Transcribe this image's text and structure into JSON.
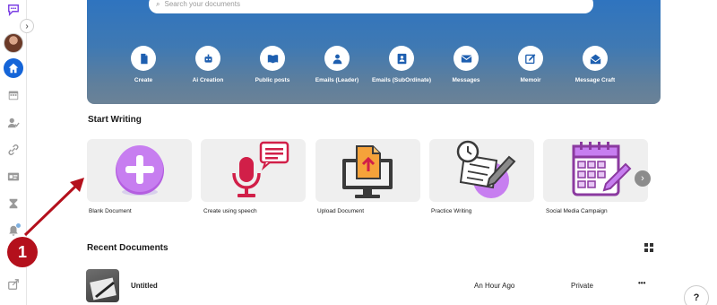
{
  "search": {
    "placeholder": "Search your documents"
  },
  "quick_actions": [
    {
      "label": "Create",
      "icon": "document-icon"
    },
    {
      "label": "Ai Creation",
      "icon": "robot-icon"
    },
    {
      "label": "Public posts",
      "icon": "book-icon"
    },
    {
      "label": "Emails (Leader)",
      "icon": "user-icon"
    },
    {
      "label": "Emails (SubOrdinate)",
      "icon": "contact-card-icon"
    },
    {
      "label": "Messages",
      "icon": "envelope-icon"
    },
    {
      "label": "Memoir",
      "icon": "edit-icon"
    },
    {
      "label": "Message Craft",
      "icon": "envelope-open-icon"
    }
  ],
  "start_writing": {
    "title": "Start Writing",
    "cards": [
      {
        "label": "Blank Document",
        "icon": "plus-circle-icon"
      },
      {
        "label": "Create using speech",
        "icon": "microphone-icon"
      },
      {
        "label": "Upload Document",
        "icon": "upload-document-icon"
      },
      {
        "label": "Practice Writing",
        "icon": "clock-writing-icon"
      },
      {
        "label": "Social Media Campaign",
        "icon": "calendar-icon"
      }
    ]
  },
  "recent": {
    "title": "Recent Documents",
    "rows": [
      {
        "name": "Untitled",
        "time": "An Hour Ago",
        "visibility": "Private",
        "menu": "•••"
      }
    ]
  },
  "annotation": {
    "number": "1",
    "color": "#b4101c"
  },
  "help": {
    "label": "?"
  },
  "sidebar": {
    "items": [
      "chat-logo-icon",
      "avatar",
      "home-icon",
      "calendar-icon",
      "user-check-icon",
      "link-icon",
      "id-card-icon",
      "hourglass-icon",
      "bell-icon",
      "share-icon"
    ]
  }
}
